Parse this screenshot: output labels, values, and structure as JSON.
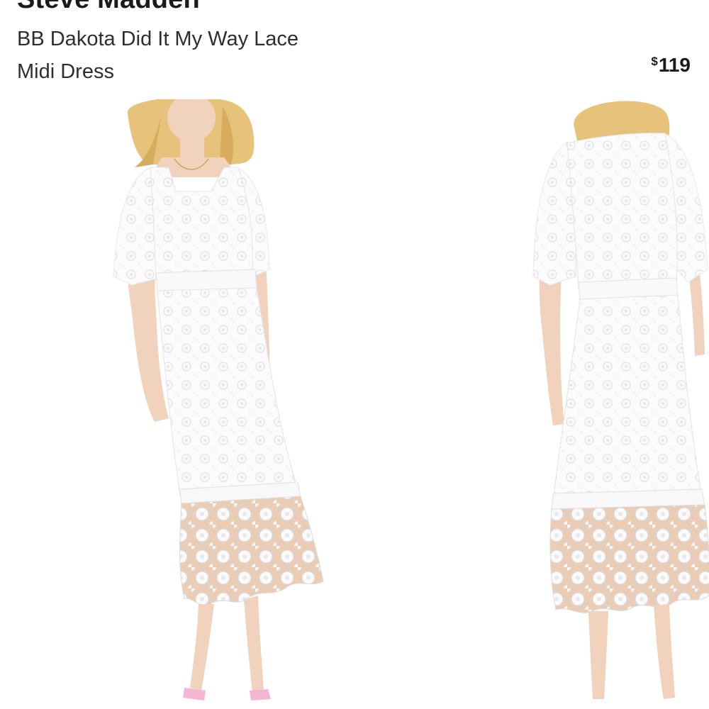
{
  "product": {
    "brand": "Steve Madden",
    "title_line1": "BB Dakota Did It My Way Lace",
    "title_line2": "Midi Dress",
    "price_currency": "$",
    "price_amount": "119"
  },
  "gallery": {
    "images": [
      {
        "view": "front",
        "dress_color": "#ffffff"
      },
      {
        "view": "back",
        "dress_color": "#ffffff"
      }
    ]
  },
  "colors": {
    "text_primary": "#1a1a1a",
    "text_secondary": "#2e2e2e",
    "hair": "#e6c27a",
    "skin": "#f1d2bc",
    "lace": "#f7f7f7",
    "shoe": "#f4b6d2"
  }
}
